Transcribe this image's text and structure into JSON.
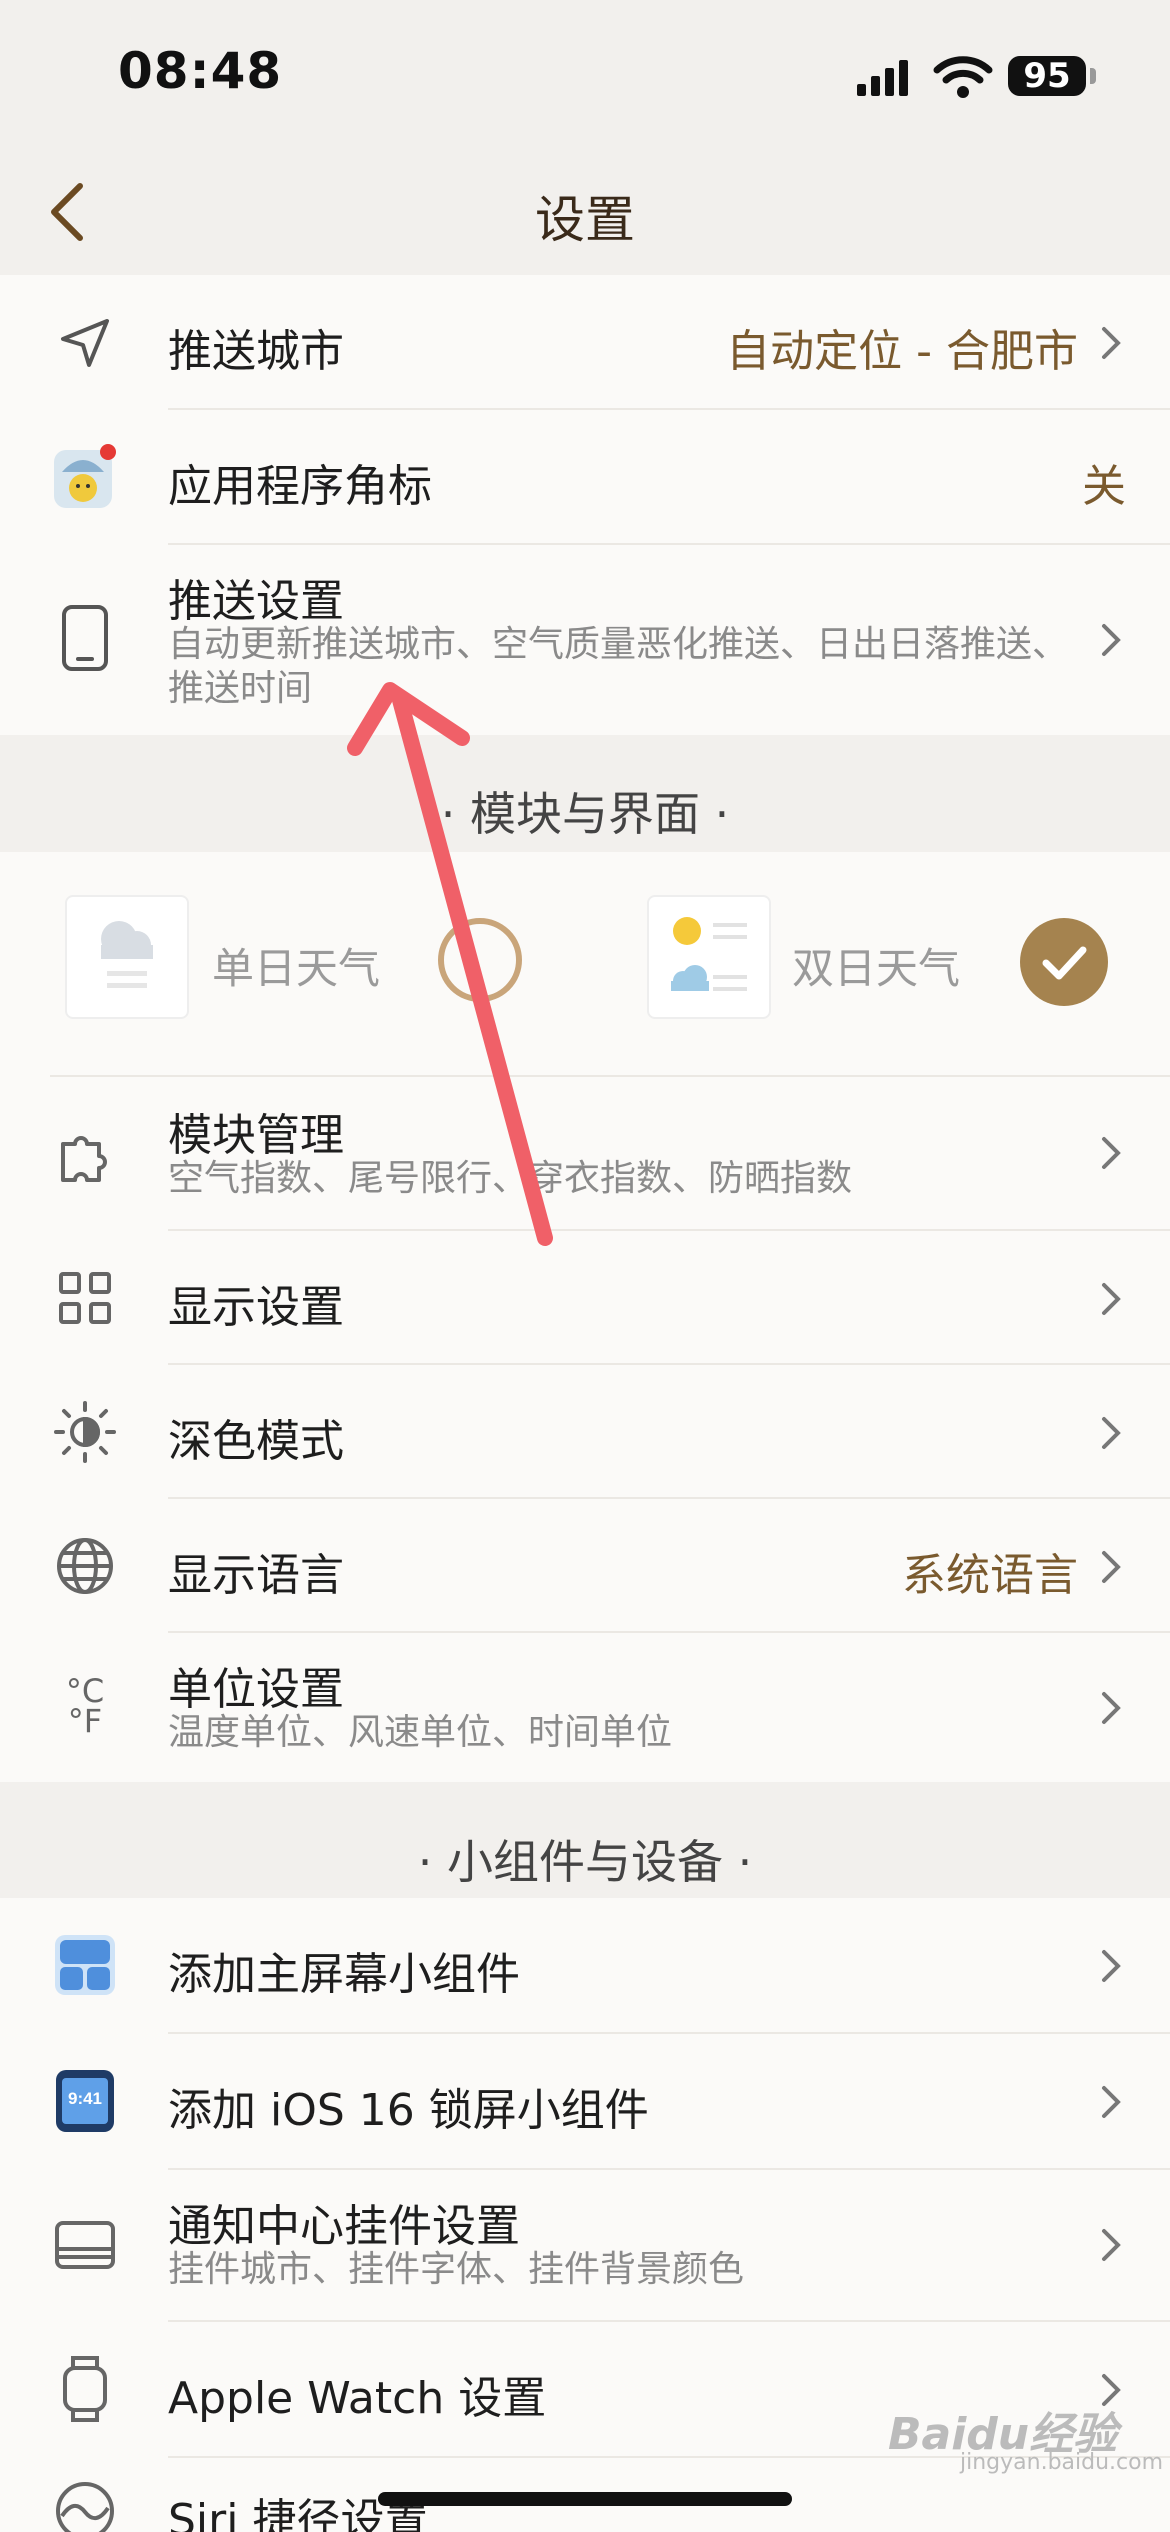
{
  "status": {
    "time": "08:48",
    "battery": "95"
  },
  "nav": {
    "title": "设置"
  },
  "push_group": [
    {
      "title": "推送城市",
      "value": "自动定位 - 合肥市"
    },
    {
      "title": "应用程序角标",
      "value": "关"
    },
    {
      "title": "推送设置",
      "subtitle": "自动更新推送城市、空气质量恶化推送、日出日落推送、推送时间"
    }
  ],
  "section_module": "· 模块与界面 ·",
  "layouts": {
    "single": "单日天气",
    "double": "双日天气",
    "selected": "double"
  },
  "module_group": [
    {
      "title": "模块管理",
      "subtitle": "空气指数、尾号限行、穿衣指数、防晒指数"
    },
    {
      "title": "显示设置"
    },
    {
      "title": "深色模式"
    },
    {
      "title": "显示语言",
      "value": "系统语言"
    },
    {
      "title": "单位设置",
      "subtitle": "温度单位、风速单位、时间单位"
    }
  ],
  "section_widget": "· 小组件与设备 ·",
  "widget_group": [
    {
      "title": "添加主屏幕小组件"
    },
    {
      "title": "添加 iOS 16 锁屏小组件",
      "icon_text": "9:41"
    },
    {
      "title": "通知中心挂件设置",
      "subtitle": "挂件城市、挂件字体、挂件背景颜色"
    },
    {
      "title": "Apple Watch 设置"
    },
    {
      "title": "Siri 捷径设置"
    }
  ],
  "unit_icon": {
    "c": "°C",
    "f": "°F"
  },
  "watermark": {
    "text": "Baidu经验",
    "sub": "jingyan.baidu.com"
  },
  "colors": {
    "accent": "#a5834f",
    "value_text": "#7a5a2e",
    "annotation_arrow": "#f06068"
  }
}
